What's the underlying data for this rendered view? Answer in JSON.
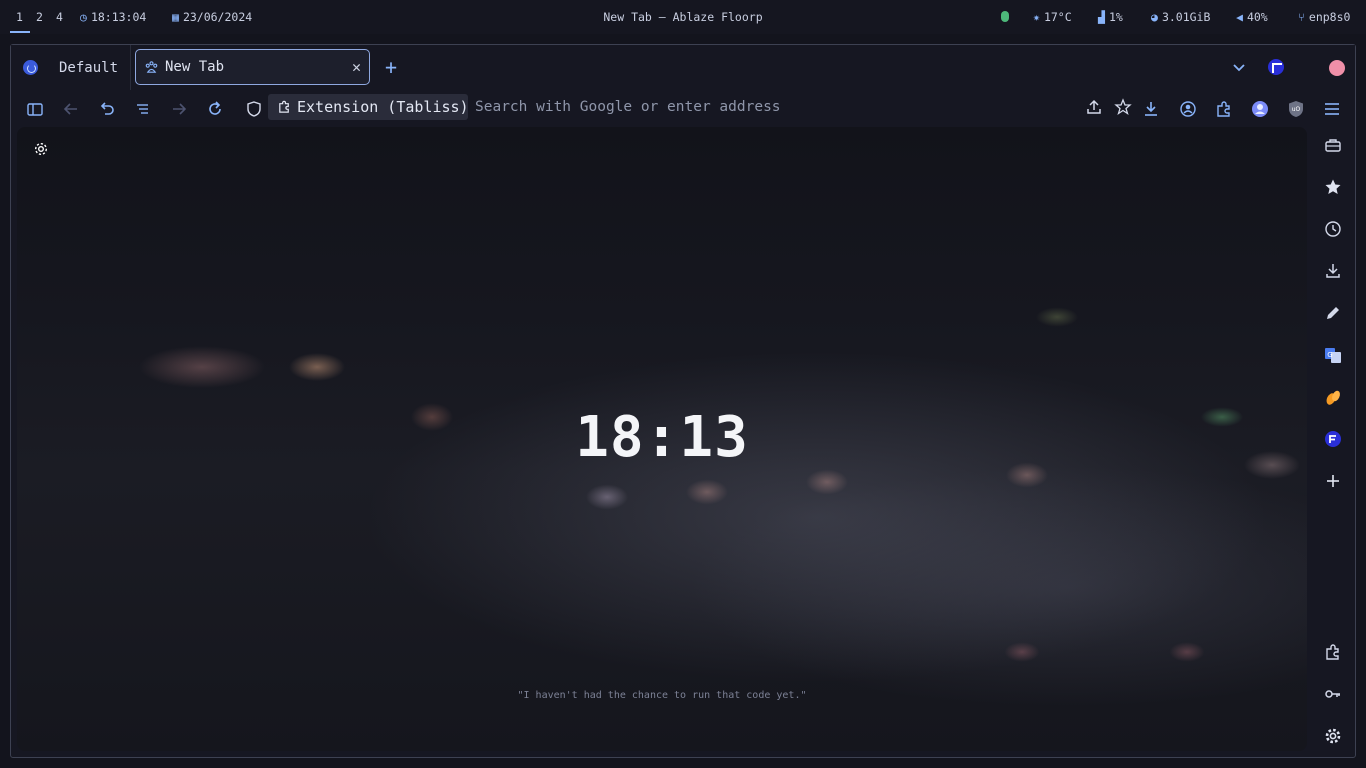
{
  "topbar": {
    "workspaces": [
      "1",
      "2",
      "4"
    ],
    "time": "18:13:04",
    "date": "23/06/2024",
    "window_title": "New Tab — Ablaze Floorp",
    "temperature": "17°C",
    "cpu": "1%",
    "memory": "3.01GiB",
    "volume": "40%",
    "network": "enp8s0"
  },
  "browser": {
    "workspace_name": "Default",
    "tab_title": "New Tab",
    "tab_close": "✕",
    "new_tab": "+",
    "extension_chip": "Extension (Tabliss)",
    "url_placeholder": "Search with Google or enter address"
  },
  "newtab": {
    "clock": "18:13",
    "quote": "\"I haven't had the chance to run that code yet.\""
  },
  "colors": {
    "accent": "#89b4fa",
    "background": "#13141d",
    "tab_border": "#8fa8e0",
    "profile_dot": "#ef8fa8"
  },
  "icons": {
    "sidebar": [
      "toolbox-icon",
      "bookmarks-star-icon",
      "history-clock-icon",
      "downloads-icon",
      "notes-pencil-icon",
      "translate-icon",
      "fruit-extension-icon",
      "floorp-app-icon",
      "add-panel-icon",
      "extensions-icon",
      "passwords-key-icon",
      "settings-gear-icon"
    ]
  }
}
